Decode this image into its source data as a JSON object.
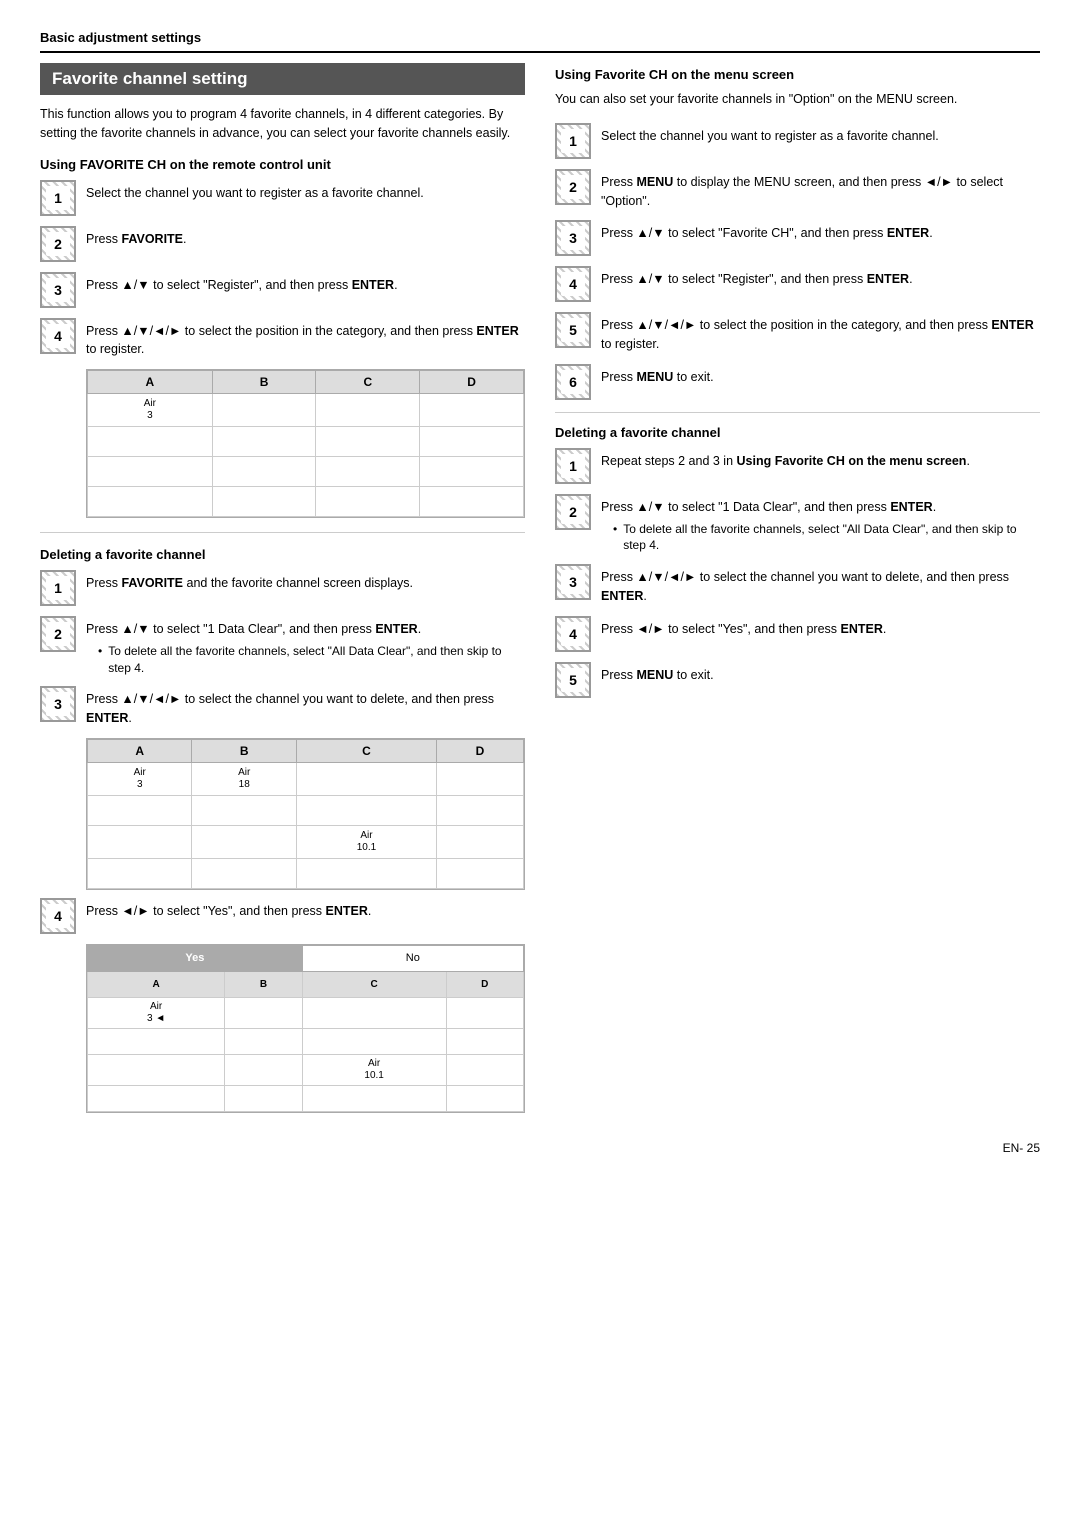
{
  "page": {
    "header": "Basic adjustment settings",
    "page_number": "EN- 25"
  },
  "left": {
    "section_title": "Favorite channel setting",
    "section_desc": "This function allows you to program 4 favorite channels, in 4 different categories. By setting the favorite channels in advance, you can select your favorite channels easily.",
    "remote_section_title": "Using FAVORITE CH on the remote control unit",
    "remote_steps": [
      {
        "num": "1",
        "text": "Select the channel you want to register as a favorite channel."
      },
      {
        "num": "2",
        "text": "Press FAVORITE.",
        "bold_parts": [
          "FAVORITE"
        ]
      },
      {
        "num": "3",
        "text": "Press ▲/▼ to select \"Register\", and then press ENTER.",
        "bold_parts": [
          "ENTER"
        ]
      },
      {
        "num": "4",
        "text": "Press ▲/▼/◄/► to select the position in the category, and then press ENTER to register.",
        "bold_parts": [
          "ENTER"
        ]
      }
    ],
    "table1": {
      "headers": [
        "A",
        "B",
        "C",
        "D"
      ],
      "rows": [
        [
          "Air\n3",
          "",
          "",
          ""
        ],
        [
          "",
          "",
          "",
          ""
        ],
        [
          "",
          "",
          "",
          ""
        ],
        [
          "",
          "",
          "",
          ""
        ]
      ]
    },
    "delete_section_title": "Deleting a favorite channel",
    "delete_steps": [
      {
        "num": "1",
        "text": "Press FAVORITE and the favorite channel screen displays.",
        "bold_parts": [
          "FAVORITE"
        ]
      },
      {
        "num": "2",
        "text": "Press ▲/▼ to select \"1 Data Clear\", and then press ENTER.",
        "bold_parts": [
          "ENTER"
        ],
        "bullet": "To delete all the favorite channels, select \"All Data Clear\", and then skip to step 4."
      },
      {
        "num": "3",
        "text": "Press ▲/▼/◄/► to select the channel you want to delete, and then press ENTER.",
        "bold_parts": [
          "ENTER"
        ]
      }
    ],
    "table2": {
      "headers": [
        "A",
        "B",
        "C",
        "D"
      ],
      "rows": [
        [
          "Air\n3",
          "Air\n18",
          "",
          ""
        ],
        [
          "",
          "",
          "",
          ""
        ],
        [
          "",
          "",
          "Air\n10.1",
          ""
        ],
        [
          "",
          "",
          "",
          ""
        ]
      ]
    },
    "delete_steps2": [
      {
        "num": "4",
        "text": "Press ◄/► to select \"Yes\", and then press ENTER.",
        "bold_parts": [
          "ENTER"
        ]
      }
    ],
    "confirm_table": {
      "yes_no": [
        "Yes",
        "No"
      ],
      "headers": [
        "A",
        "B",
        "C",
        "D"
      ],
      "rows": [
        [
          "Air\n3 ◄",
          "",
          "",
          ""
        ],
        [
          "",
          "",
          "",
          ""
        ],
        [
          "",
          "",
          "Air\n10.1",
          ""
        ],
        [
          "",
          "",
          "",
          ""
        ]
      ]
    }
  },
  "right": {
    "menu_section_title": "Using Favorite CH on the menu screen",
    "menu_desc": "You can also set your favorite channels in \"Option\" on the MENU screen.",
    "menu_steps": [
      {
        "num": "1",
        "text": "Select the channel you want to register as a favorite channel."
      },
      {
        "num": "2",
        "text": "Press MENU to display the MENU screen, and then press ◄/► to select \"Option\".",
        "bold_parts": [
          "MENU"
        ]
      },
      {
        "num": "3",
        "text": "Press ▲/▼ to select \"Favorite CH\", and then press ENTER.",
        "bold_parts": [
          "ENTER"
        ]
      },
      {
        "num": "4",
        "text": "Press ▲/▼ to select \"Register\", and then press ENTER.",
        "bold_parts": [
          "ENTER"
        ]
      },
      {
        "num": "5",
        "text": "Press ▲/▼/◄/► to select the position in the category, and then press ENTER to register.",
        "bold_parts": [
          "ENTER"
        ]
      },
      {
        "num": "6",
        "text": "Press MENU to exit.",
        "bold_parts": [
          "MENU"
        ]
      }
    ],
    "delete_section_title": "Deleting a favorite channel",
    "delete_steps": [
      {
        "num": "1",
        "text": "Repeat steps 2 and 3 in Using Favorite CH on the menu screen.",
        "bold_parts": [
          "Using Favorite CH on the menu screen"
        ]
      },
      {
        "num": "2",
        "text": "Press ▲/▼ to select \"1 Data Clear\", and then press ENTER.",
        "bold_parts": [
          "ENTER"
        ],
        "bullet": "To delete all the favorite channels, select \"All Data Clear\", and then skip to step 4."
      },
      {
        "num": "3",
        "text": "Press ▲/▼/◄/► to select the channel you want to delete, and then press ENTER.",
        "bold_parts": [
          "ENTER"
        ]
      },
      {
        "num": "4",
        "text": "Press ◄/► to select \"Yes\", and then press ENTER.",
        "bold_parts": [
          "ENTER"
        ]
      },
      {
        "num": "5",
        "text": "Press MENU to exit.",
        "bold_parts": [
          "MENU"
        ]
      }
    ]
  }
}
